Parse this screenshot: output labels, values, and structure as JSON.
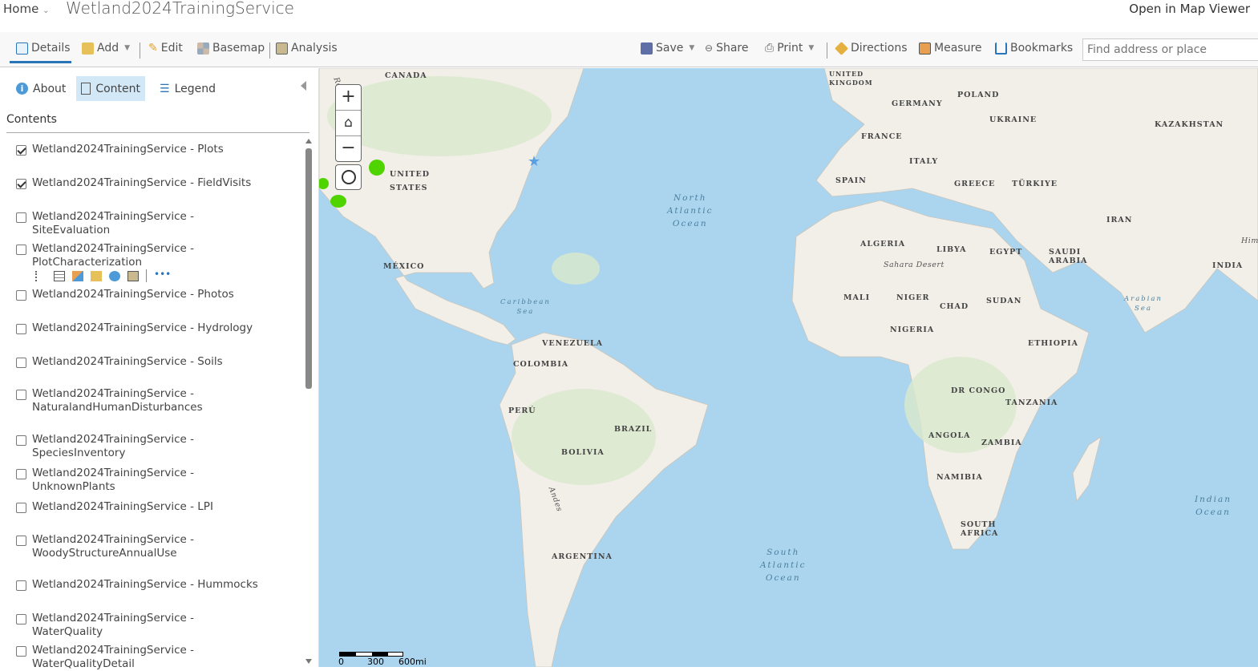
{
  "header": {
    "home": "Home",
    "title": "Wetland2024TrainingService",
    "open_viewer": "Open in Map Viewer"
  },
  "toolbar": {
    "details": "Details",
    "add": "Add",
    "edit": "Edit",
    "basemap": "Basemap",
    "analysis": "Analysis",
    "save": "Save",
    "share": "Share",
    "print": "Print",
    "directions": "Directions",
    "measure": "Measure",
    "bookmarks": "Bookmarks",
    "search_placeholder": "Find address or place"
  },
  "sidebar": {
    "tabs": {
      "about": "About",
      "content": "Content",
      "legend": "Legend"
    },
    "heading": "Contents",
    "layers": [
      {
        "label": "Wetland2024TrainingService - Plots",
        "checked": true
      },
      {
        "label": "Wetland2024TrainingService - FieldVisits",
        "checked": true
      },
      {
        "label": "Wetland2024TrainingService - SiteEvaluation",
        "checked": false
      },
      {
        "label": "Wetland2024TrainingService - PlotCharacterization",
        "checked": false
      },
      {
        "label": "Wetland2024TrainingService - Photos",
        "checked": false
      },
      {
        "label": "Wetland2024TrainingService - Hydrology",
        "checked": false
      },
      {
        "label": "Wetland2024TrainingService - Soils",
        "checked": false
      },
      {
        "label": "Wetland2024TrainingService - NaturalandHumanDisturbances",
        "checked": false
      },
      {
        "label": "Wetland2024TrainingService - SpeciesInventory",
        "checked": false
      },
      {
        "label": "Wetland2024TrainingService - UnknownPlants",
        "checked": false
      },
      {
        "label": "Wetland2024TrainingService - LPI",
        "checked": false
      },
      {
        "label": "Wetland2024TrainingService - WoodyStructureAnnualUse",
        "checked": false
      },
      {
        "label": "Wetland2024TrainingService - Hummocks",
        "checked": false
      },
      {
        "label": "Wetland2024TrainingService - WaterQuality",
        "checked": false
      },
      {
        "label": "Wetland2024TrainingService - WaterQualityDetail",
        "checked": false
      }
    ]
  },
  "map": {
    "countries": [
      "CANADA",
      "UNITED STATES",
      "MÉXICO",
      "VENEZUELA",
      "COLOMBIA",
      "PERÚ",
      "BRAZIL",
      "BOLIVIA",
      "ARGENTINA",
      "UNITED KINGDOM",
      "GERMANY",
      "POLAND",
      "UKRAINE",
      "FRANCE",
      "SPAIN",
      "ITALY",
      "GREECE",
      "TÜRKIYE",
      "KAZAKHSTAN",
      "IRAN",
      "ALGERIA",
      "LIBYA",
      "EGYPT",
      "SAUDI ARABIA",
      "INDIA",
      "MALI",
      "NIGER",
      "CHAD",
      "SUDAN",
      "NIGERIA",
      "ETHIOPIA",
      "DR CONGO",
      "TANZANIA",
      "ANGOLA",
      "ZAMBIA",
      "NAMIBIA",
      "SOUTH AFRICA"
    ],
    "features": [
      "Sahara Desert",
      "Rocky Mts",
      "Andes",
      "Himal"
    ],
    "oceans": [
      "North Atlantic Ocean",
      "Caribbean Sea",
      "South Atlantic Ocean",
      "Arabian Sea",
      "Indian Ocean"
    ],
    "scale": [
      "0",
      "300",
      "600mi"
    ],
    "colors": {
      "ocean": "#abd5ee",
      "land": "#f1efe8",
      "veg": "#dbe8cc",
      "points": "#4fd400"
    }
  }
}
